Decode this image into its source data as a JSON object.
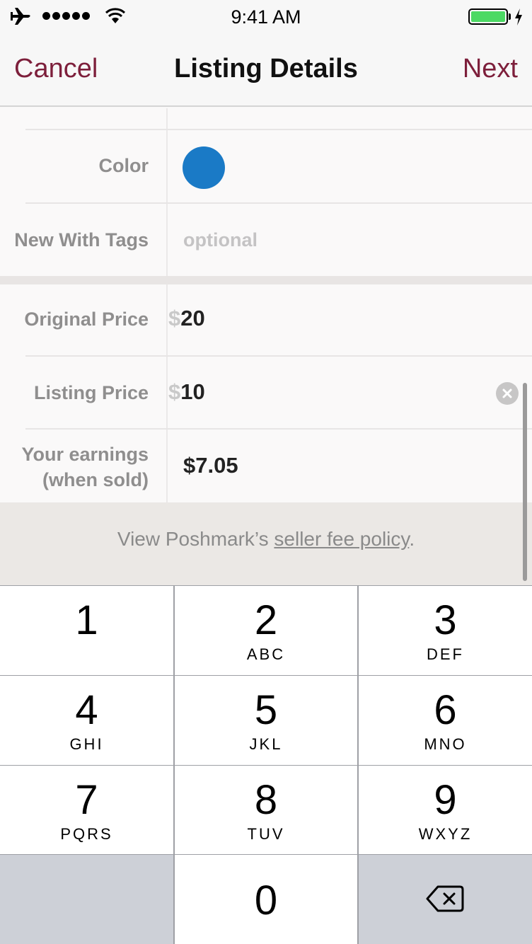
{
  "status_bar": {
    "time": "9:41 AM",
    "icons": [
      "airplane-icon",
      "signal-dots-icon",
      "wifi-icon",
      "battery-icon",
      "charging-bolt-icon"
    ],
    "signal_dots": 5,
    "battery_level": 1.0,
    "battery_color": "#4cd964"
  },
  "nav": {
    "cancel_label": "Cancel",
    "title": "Listing Details",
    "next_label": "Next",
    "accent_color": "#7d1f3b"
  },
  "form": {
    "rows": [
      {
        "label": "Color",
        "value_type": "swatch",
        "swatch_color": "#1a7ac6"
      },
      {
        "label": "New With Tags",
        "placeholder": "optional"
      },
      {
        "label": "Original Price",
        "currency": "$",
        "value": "20"
      },
      {
        "label": "Listing Price",
        "currency": "$",
        "value": "10",
        "clear_icon": "clear-circle-icon"
      },
      {
        "label_line1": "Your earnings",
        "label_line2": "(when sold)",
        "value": "$7.05"
      }
    ],
    "fee_note": {
      "prefix": "View Poshmark’s ",
      "link": "seller fee policy",
      "suffix": "."
    }
  },
  "keypad": {
    "keys": [
      {
        "digit": "1",
        "letters": ""
      },
      {
        "digit": "2",
        "letters": "ABC"
      },
      {
        "digit": "3",
        "letters": "DEF"
      },
      {
        "digit": "4",
        "letters": "GHI"
      },
      {
        "digit": "5",
        "letters": "JKL"
      },
      {
        "digit": "6",
        "letters": "MNO"
      },
      {
        "digit": "7",
        "letters": "PQRS"
      },
      {
        "digit": "8",
        "letters": "TUV"
      },
      {
        "digit": "9",
        "letters": "WXYZ"
      },
      {
        "digit": "0",
        "letters": ""
      }
    ],
    "backspace_icon": "backspace-icon"
  }
}
